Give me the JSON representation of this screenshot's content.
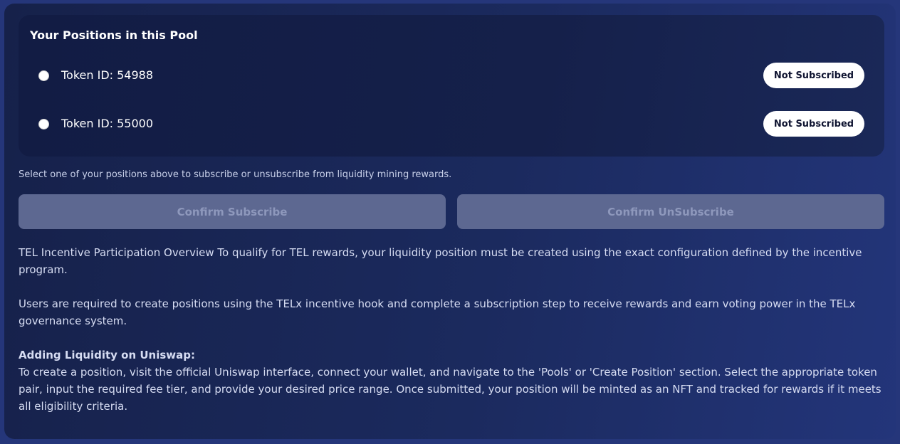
{
  "positions": {
    "title": "Your Positions in this Pool",
    "items": [
      {
        "token_label": "Token ID: 54988",
        "status": "Not Subscribed"
      },
      {
        "token_label": "Token ID: 55000",
        "status": "Not Subscribed"
      }
    ]
  },
  "hint": "Select one of your positions above to subscribe or unsubscribe from liquidity mining rewards.",
  "buttons": {
    "subscribe": "Confirm Subscribe",
    "unsubscribe": "Confirm UnSubscribe"
  },
  "overview": {
    "para1": "TEL Incentive Participation Overview To qualify for TEL rewards, your liquidity position must be created using the exact configuration defined by the incentive program.",
    "para2": "Users are required to create positions using the TELx incentive hook and complete a subscription step to receive rewards and earn voting power in the TELx governance system.",
    "heading": "Adding Liquidity on Uniswap:",
    "para3": "To create a position, visit the official Uniswap interface, connect your wallet, and navigate to the 'Pools' or 'Create Position' section. Select the appropriate token pair, input the required fee tier, and provide your desired price range. Once submitted, your position will be minted as an NFT and tracked for rewards if it meets all eligibility criteria."
  }
}
